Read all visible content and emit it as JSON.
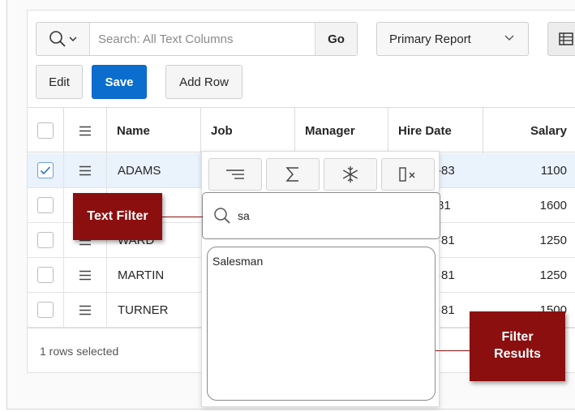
{
  "toolbar": {
    "search_placeholder": "Search: All Text Columns",
    "go_label": "Go",
    "report_select": "Primary Report"
  },
  "actions": {
    "edit_label": "Edit",
    "save_label": "Save",
    "add_row_label": "Add Row"
  },
  "grid": {
    "columns": [
      "Name",
      "Job",
      "Manager",
      "Hire Date",
      "Salary"
    ],
    "rows": [
      {
        "name": "ADAMS",
        "hire_date": "-83",
        "salary": "1100",
        "selected": true
      },
      {
        "name": "",
        "hire_date": "81",
        "salary": "1600",
        "selected": false
      },
      {
        "name": "WARD",
        "hire_date": "·81",
        "salary": "1250",
        "selected": false
      },
      {
        "name": "MARTIN",
        "hire_date": "·81",
        "salary": "1250",
        "selected": false
      },
      {
        "name": "TURNER",
        "hire_date": "·81",
        "salary": "1500",
        "selected": false
      }
    ],
    "footer": "1 rows selected"
  },
  "column_menu": {
    "filter_value": "sa",
    "results": [
      "Salesman"
    ]
  },
  "callouts": {
    "text_filter": "Text Filter",
    "filter_results": "Filter Results"
  },
  "colors": {
    "accent": "#0b6ecf",
    "callout": "#8b0f0f",
    "selected_row": "#eaf2fc"
  }
}
